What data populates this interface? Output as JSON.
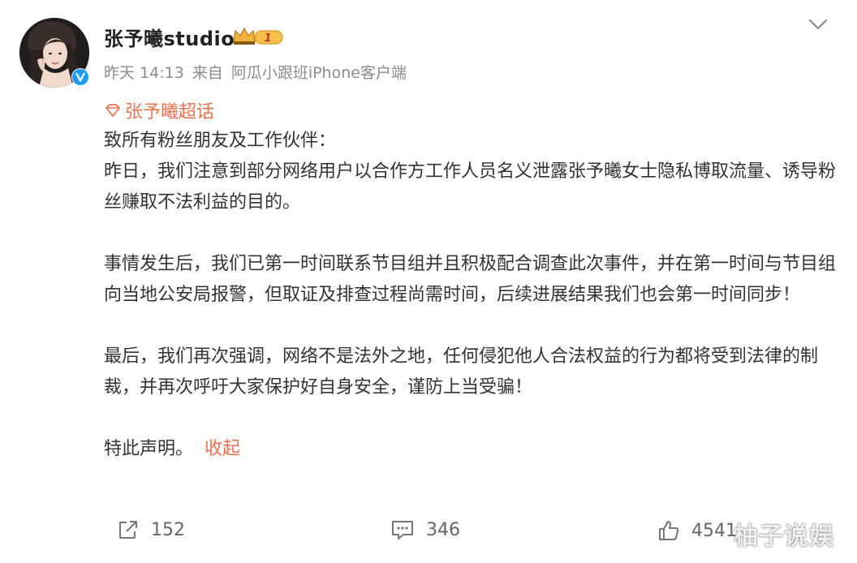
{
  "header": {
    "username": "张予曦studio",
    "vip_level": "1",
    "time": "昨天 14:13",
    "source_prefix": "来自",
    "source": "阿瓜小跟班iPhone客户端"
  },
  "topic": {
    "label": "张予曦超话"
  },
  "content": {
    "greeting": "致所有粉丝朋友及工作伙伴：",
    "para1": "昨日，我们注意到部分网络用户以合作方工作人员名义泄露张予曦女士隐私博取流量、诱导粉丝赚取不法利益的目的。",
    "para2": "事情发生后，我们已第一时间联系节目组并且积极配合调查此次事件，并在第一时间与节目组向当地公安局报警，但取证及排查过程尚需时间，后续进展结果我们也会第一时间同步！",
    "para3": "最后，我们再次强调，网络不是法外之地，任何侵犯他人合法权益的行为都将受到法律的制裁，并再次呼吁大家保护好自身安全，谨防上当受骗！",
    "closing": "特此声明。",
    "collapse_label": "收起"
  },
  "actions": {
    "repost_count": "152",
    "comment_count": "346",
    "like_count": "4541"
  },
  "watermark": "柚子说娱",
  "colors": {
    "accent": "#eb7350",
    "verified": "#1d9bf0",
    "text": "#333333",
    "meta": "#8c8c8c"
  }
}
